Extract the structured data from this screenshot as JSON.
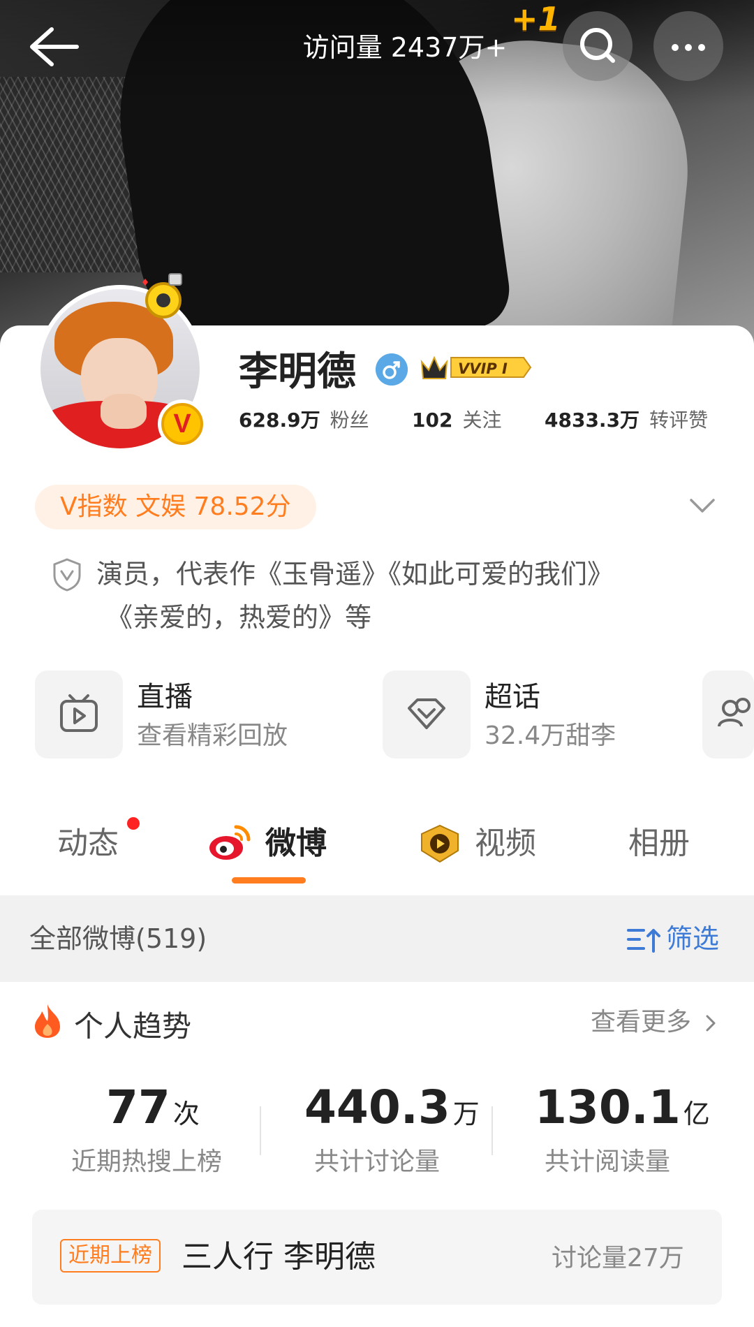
{
  "header": {
    "visits_label": "访问量 2437万+",
    "plus_badge": "+1"
  },
  "profile": {
    "name": "李明德",
    "vvip_label": "VVIP I",
    "avatar_badge": "V",
    "stats": [
      {
        "value": "628.9万",
        "label": "粉丝"
      },
      {
        "value": "102",
        "label": "关注"
      },
      {
        "value": "4833.3万",
        "label": "转评赞"
      }
    ],
    "v_index": "V指数 文娱 78.52分",
    "bio_line1": "演员，代表作《玉骨遥》《如此可爱的我们》",
    "bio_line2": "《亲爱的，热爱的》等"
  },
  "features": [
    {
      "title": "直播",
      "subtitle": "查看精彩回放",
      "icon": "tv-play-icon"
    },
    {
      "title": "超话",
      "subtitle": "32.4万甜李",
      "icon": "diamond-icon"
    }
  ],
  "tabs": [
    {
      "label": "动态",
      "active": false
    },
    {
      "label": "微博",
      "active": true
    },
    {
      "label": "视频",
      "active": false
    },
    {
      "label": "相册",
      "active": false
    }
  ],
  "filter_bar": {
    "all_label": "全部微博(519)",
    "filter_label": "筛选"
  },
  "trend": {
    "title": "个人趋势",
    "see_more": "查看更多",
    "metrics": [
      {
        "value": "77",
        "unit": "次",
        "label": "近期热搜上榜"
      },
      {
        "value": "440.3",
        "unit": "万",
        "label": "共计讨论量"
      },
      {
        "value": "130.1",
        "unit": "亿",
        "label": "共计阅读量"
      }
    ],
    "hot_item": {
      "tag": "近期上榜",
      "title": "三人行 李明德",
      "count": "讨论量27万"
    }
  },
  "colors": {
    "accent_orange": "#ff7d1e",
    "link_blue": "#3d7bd6",
    "red_dot": "#ff2222"
  }
}
